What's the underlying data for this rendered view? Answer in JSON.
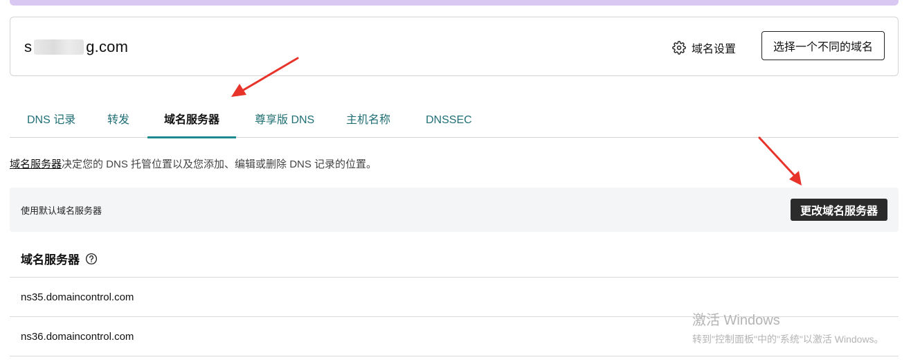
{
  "domain": {
    "name_prefix": "s",
    "name_suffix": "g.com",
    "settings_label": "域名设置",
    "choose_label": "选择一个不同的域名"
  },
  "tabs": [
    {
      "label": "DNS 记录",
      "active": false
    },
    {
      "label": "转发",
      "active": false
    },
    {
      "label": "域名服务器",
      "active": true
    },
    {
      "label": "尊享版 DNS",
      "active": false
    },
    {
      "label": "主机名称",
      "active": false
    },
    {
      "label": "DNSSEC",
      "active": false
    }
  ],
  "description": {
    "link_text": "域名服务器",
    "rest_text": "决定您的 DNS 托管位置以及您添加、编辑或删除 DNS 记录的位置。"
  },
  "default_bar": {
    "text": "使用默认域名服务器",
    "change_button": "更改域名服务器"
  },
  "nameservers": {
    "header": "域名服务器",
    "items": [
      "ns35.domaincontrol.com",
      "ns36.domaincontrol.com"
    ]
  },
  "watermark": {
    "line1": "激活 Windows",
    "line2": "转到\"控制面板\"中的\"系统\"以激活 Windows。"
  },
  "colors": {
    "tab_accent": "#1b8a8e",
    "tab_text": "#1f6f75",
    "annotation_arrow": "#e8332b",
    "top_strip": "#d9c8f1"
  },
  "icons": [
    "gear-icon",
    "help-circle-icon",
    "annotation-arrow"
  ]
}
